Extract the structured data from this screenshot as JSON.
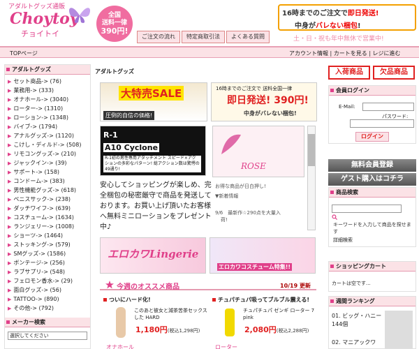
{
  "header": {
    "logo_top": "アダルトグッズ通販",
    "logo_main": "Choytoy",
    "logo_sub": "チョイトイ",
    "ship_badge_l1": "全国",
    "ship_badge_l2": "送料一律",
    "ship_badge_l3": "390円!",
    "nav": [
      "ご注文の流れ",
      "特定商取引法",
      "よくある質問"
    ],
    "promo_l1_a": "16時までのご注文で",
    "promo_l1_b": "即日発送!",
    "promo_l2_a": "中身が",
    "promo_l2_b": "バレない梱包",
    "promo_l2_c": "!",
    "open_note": "土・日・祝も年中無休で営業中!"
  },
  "topbar": {
    "top_link": "TOPページ",
    "account_links": "アカウント情報 | カートを見る | レジに進む"
  },
  "left": {
    "section_title": "アダルトグッズ",
    "categories": [
      "セット商品-> (76)",
      "業務用-> (333)",
      "オナホール-> (3040)",
      "ローター-> (1310)",
      "ローション-> (1348)",
      "バイブ-> (1794)",
      "アナルグッズ-> (1120)",
      "こけし・ディルド-> (508)",
      "リモコングッズ-> (210)",
      "ジャックイン-> (39)",
      "サポート-> (158)",
      "コンドーム-> (383)",
      "男性機能グッズ-> (618)",
      "ペニスサック-> (238)",
      "ダッチワイフ-> (639)",
      "コスチューム-> (1634)",
      "ランジェリー-> (1008)",
      "ショーツ-> (1464)",
      "ストッキング-> (579)",
      "SMグッズ-> (1586)",
      "ボンテージ-> (256)",
      "ラブサプリ-> (548)",
      "フェロモン香水-> (29)",
      "面白グッズ-> (56)",
      "TATTOO-> (890)",
      "その他-> (792)"
    ],
    "maker_title": "メーカー検索",
    "maker_select": "選択してください"
  },
  "center": {
    "title": "アダルトグッズ",
    "sale_title": "大特売SALE",
    "sale_sub": "圧倒的自信の価格!",
    "ship_l1": "16時までのご注文で 送料全国一律",
    "ship_l2": "即日発送! 390円!",
    "ship_l3": "中身がバレない梱包!",
    "cyclone_t1": "R-1",
    "cyclone_t2": "A10 Cyclone",
    "cyclone_t3": "R-1初の男性専用アタッチメント スピード×アクションの多彩なパターン! 総アクション数は驚愕の49通り!",
    "rose_title": "ROSE",
    "intro": "安心してショッピングが楽しめ、完全梱包の秘密厳守で商品を発送しております。お買い上げ頂いたお客様へ無料ミニローションをプレゼント中♪",
    "news1": "お得な商品が日白押し!",
    "news2": "▼新着情報",
    "news3": "9/6　最新作☆290点を大量入",
    "news4": "荷!",
    "lingerie_title": "エロカワLingerie",
    "costume_title": "エロカワコスチューム特集!!",
    "recommend_title": "今週のオススメ商品",
    "recommend_date": "10/19 更新",
    "products": [
      {
        "head": "ついにハード化!",
        "desc": "このあと彼女と減茶苦茶セックスした HARD",
        "price": "1,180円",
        "tax": "(税込1,298円)",
        "cat": "オナホール"
      },
      {
        "head": "チュパチュパ吸ってブルブル震える!",
        "desc": "チュパチュパ ゼンギ ローター 7 pink",
        "price": "2,080円",
        "tax": "(税込2,288円)",
        "cat": "ローター"
      }
    ]
  },
  "right": {
    "new_items": "入荷商品",
    "soldout_items": "欠品商品",
    "login_title": "会員ログイン",
    "email_label": "E-Mail:",
    "password_label": "パスワード:",
    "login_button": "ログイン",
    "register_button": "無料会員登録",
    "guest_button": "ゲスト購入はコチラ",
    "search_title": "商品検索",
    "search_hint": "キーワードを入力して商品を探せます",
    "search_detail": "詳細検索",
    "cart_title": "ショッピングカート",
    "cart_text": "カートは空です...",
    "rank_title": "週間ランキング",
    "rank1": "01. ビッグ・ハニー　144個",
    "rank2": "02. マニアックワ"
  },
  "colors": {
    "accent_pink": "#e0408a",
    "light_pink": "#fbe2e6",
    "red": "#e02020",
    "orange": "#f3a000"
  }
}
